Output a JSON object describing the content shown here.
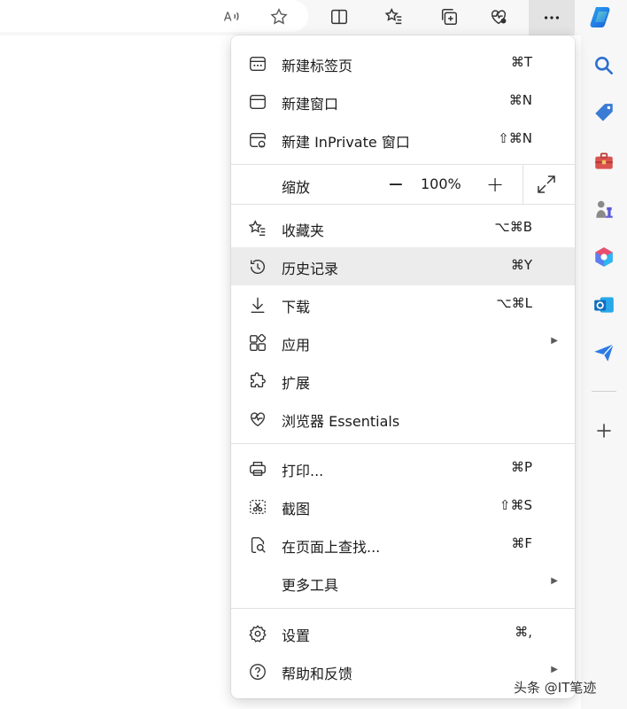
{
  "toolbar": {
    "icons": [
      "read-aloud-icon",
      "favorite-star-icon",
      "split-screen-icon",
      "favorites-icon",
      "collections-icon",
      "browser-essentials-icon",
      "more-icon",
      "copilot-icon"
    ]
  },
  "menu": {
    "items_top": [
      {
        "label": "新建标签页",
        "shortcut": "⌘T",
        "icon": "new-tab-icon"
      },
      {
        "label": "新建窗口",
        "shortcut": "⌘N",
        "icon": "new-window-icon"
      },
      {
        "label": "新建 InPrivate 窗口",
        "shortcut": "⇧⌘N",
        "icon": "inprivate-window-icon"
      }
    ],
    "zoom": {
      "label": "缩放",
      "minus": "−",
      "value": "100%",
      "plus": "+"
    },
    "items_mid": [
      {
        "label": "收藏夹",
        "shortcut": "⌥⌘B",
        "icon": "favorites-icon"
      },
      {
        "label": "历史记录",
        "shortcut": "⌘Y",
        "icon": "history-icon"
      },
      {
        "label": "下载",
        "shortcut": "⌥⌘L",
        "icon": "download-icon"
      },
      {
        "label": "应用",
        "shortcut": "",
        "icon": "apps-icon",
        "submenu": true
      },
      {
        "label": "扩展",
        "shortcut": "",
        "icon": "extensions-icon"
      },
      {
        "label": "浏览器 Essentials",
        "shortcut": "",
        "icon": "browser-essentials-icon"
      }
    ],
    "items_tools": [
      {
        "label": "打印...",
        "shortcut": "⌘P",
        "icon": "print-icon"
      },
      {
        "label": "截图",
        "shortcut": "⇧⌘S",
        "icon": "screenshot-icon"
      },
      {
        "label": "在页面上查找...",
        "shortcut": "⌘F",
        "icon": "find-on-page-icon"
      },
      {
        "label": "更多工具",
        "shortcut": "",
        "icon": "",
        "submenu": true
      }
    ],
    "items_bottom": [
      {
        "label": "设置",
        "shortcut": "⌘,",
        "icon": "settings-icon"
      },
      {
        "label": "帮助和反馈",
        "shortcut": "",
        "icon": "help-icon",
        "submenu": true
      }
    ]
  },
  "sidebar": {
    "icons": [
      "search-icon",
      "shopping-tag-icon",
      "tools-icon",
      "games-icon",
      "microsoft365-icon",
      "outlook-icon",
      "send-icon",
      "add-icon"
    ]
  },
  "watermark": "头条 @IT笔迹",
  "colors": {
    "hover": "#ececec",
    "active_button": "#e3e3e3",
    "tag_blue": "#3a7bd5",
    "tools_red": "#d9534f",
    "outlook_blue": "#0f6cbd"
  }
}
